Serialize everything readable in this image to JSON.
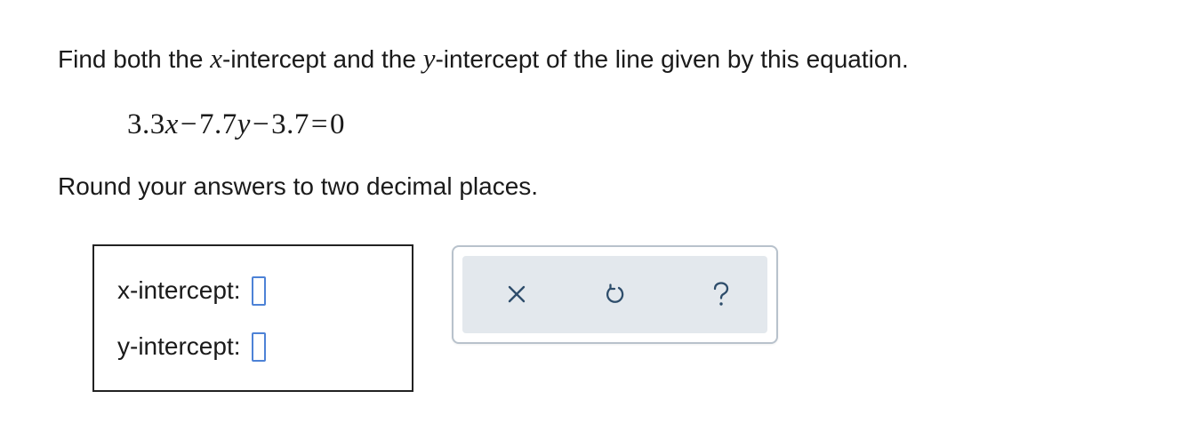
{
  "question": {
    "prefix": "Find both the ",
    "var_x": "x",
    "middle": "-intercept and the ",
    "var_y": "y",
    "suffix": "-intercept of the line given by this equation."
  },
  "equation": {
    "c1": "3.3",
    "v1": "x",
    "op1": "−",
    "c2": "7.7",
    "v2": "y",
    "op2": "−",
    "c3": "3.7",
    "eq": "=",
    "rhs": "0"
  },
  "instruction": "Round your answers to two decimal places.",
  "answers": {
    "x_label": "x-intercept:",
    "x_value": "",
    "y_label": "y-intercept:",
    "y_value": ""
  },
  "toolbar": {
    "clear_icon": "close-icon",
    "undo_icon": "undo-icon",
    "help_icon": "question-mark-icon",
    "icon_color": "#2e4d6b",
    "input_border_color": "#4d82d6"
  }
}
